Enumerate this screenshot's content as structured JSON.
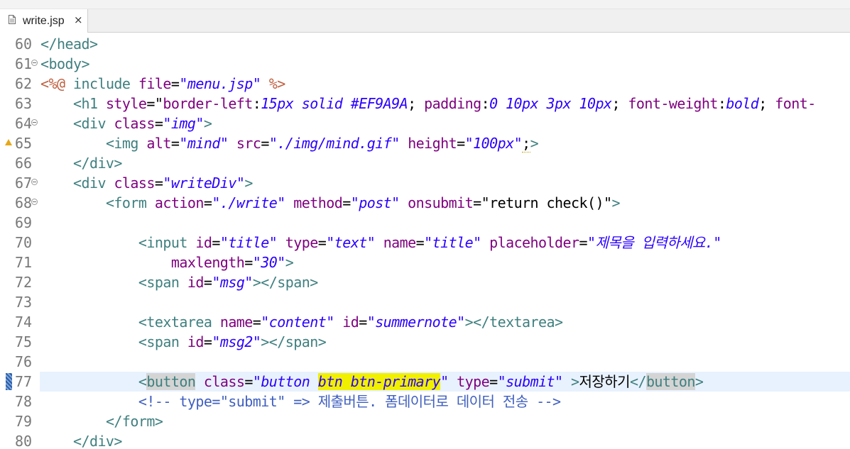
{
  "tab": {
    "filename": "write.jsp",
    "close_glyph": "×",
    "icon": "file-icon"
  },
  "colors": {
    "tag": "#3f7f7f",
    "attribute": "#7f007f",
    "string": "#2a00ff",
    "jsp": "#bf5f3f",
    "comment": "#3f5fbf",
    "current_line": "#e8f2fe",
    "highlight": "#f0f000"
  },
  "lines": [
    {
      "n": "60",
      "fold": false,
      "tokens": [
        {
          "t": "</head>",
          "c": "t-tagname"
        }
      ]
    },
    {
      "n": "61",
      "fold": true,
      "tokens": [
        {
          "t": "<body>",
          "c": "t-tagname"
        }
      ]
    },
    {
      "n": "62",
      "fold": false,
      "tokens": [
        {
          "t": "<%@",
          "c": "t-jsp"
        },
        {
          "t": " include ",
          "c": "t-tagname"
        },
        {
          "t": "file",
          "c": "t-attr"
        },
        {
          "t": "=",
          "c": "t-plain"
        },
        {
          "t": "\"menu.jsp\"",
          "c": "t-str"
        },
        {
          "t": " ",
          "c": "t-plain"
        },
        {
          "t": "%>",
          "c": "t-jsp"
        }
      ]
    },
    {
      "n": "63",
      "fold": false,
      "tokens": [
        {
          "t": "    ",
          "c": "t-plain"
        },
        {
          "t": "<h1 ",
          "c": "t-tagname"
        },
        {
          "t": "style",
          "c": "t-attr"
        },
        {
          "t": "=\"",
          "c": "t-plain"
        },
        {
          "t": "border-left",
          "c": "t-attr"
        },
        {
          "t": ":",
          "c": "t-plain"
        },
        {
          "t": "15px solid #EF9A9A",
          "c": "t-val"
        },
        {
          "t": "; ",
          "c": "t-plain"
        },
        {
          "t": "padding",
          "c": "t-attr"
        },
        {
          "t": ":",
          "c": "t-plain"
        },
        {
          "t": "0 10px 3px 10px",
          "c": "t-val"
        },
        {
          "t": "; ",
          "c": "t-plain"
        },
        {
          "t": "font-weight",
          "c": "t-attr"
        },
        {
          "t": ":",
          "c": "t-plain"
        },
        {
          "t": "bold",
          "c": "t-val"
        },
        {
          "t": "; ",
          "c": "t-plain"
        },
        {
          "t": "font-",
          "c": "t-attr"
        }
      ]
    },
    {
      "n": "64",
      "fold": true,
      "tokens": [
        {
          "t": "    ",
          "c": "t-plain"
        },
        {
          "t": "<div ",
          "c": "t-tagname"
        },
        {
          "t": "class",
          "c": "t-attr"
        },
        {
          "t": "=",
          "c": "t-plain"
        },
        {
          "t": "\"img\"",
          "c": "t-str"
        },
        {
          "t": ">",
          "c": "t-tagname"
        }
      ]
    },
    {
      "n": "65",
      "fold": false,
      "warn": true,
      "tokens": [
        {
          "t": "        ",
          "c": "t-plain"
        },
        {
          "t": "<img ",
          "c": "t-tagname"
        },
        {
          "t": "alt",
          "c": "t-attr"
        },
        {
          "t": "=",
          "c": "t-plain"
        },
        {
          "t": "\"mind\"",
          "c": "t-str"
        },
        {
          "t": " ",
          "c": "t-plain"
        },
        {
          "t": "src",
          "c": "t-attr"
        },
        {
          "t": "=",
          "c": "t-plain"
        },
        {
          "t": "\"./img/mind.gif\"",
          "c": "t-str"
        },
        {
          "t": " ",
          "c": "t-plain"
        },
        {
          "t": "height",
          "c": "t-attr"
        },
        {
          "t": "=",
          "c": "t-plain"
        },
        {
          "t": "\"100px\"",
          "c": "t-str"
        },
        {
          "t": ";",
          "c": "t-plain caret-mark"
        },
        {
          "t": ">",
          "c": "t-tagname"
        }
      ]
    },
    {
      "n": "66",
      "fold": false,
      "tokens": [
        {
          "t": "    ",
          "c": "t-plain"
        },
        {
          "t": "</div>",
          "c": "t-tagname"
        }
      ]
    },
    {
      "n": "67",
      "fold": true,
      "tokens": [
        {
          "t": "    ",
          "c": "t-plain"
        },
        {
          "t": "<div ",
          "c": "t-tagname"
        },
        {
          "t": "class",
          "c": "t-attr"
        },
        {
          "t": "=",
          "c": "t-plain"
        },
        {
          "t": "\"writeDiv\"",
          "c": "t-str"
        },
        {
          "t": ">",
          "c": "t-tagname"
        }
      ]
    },
    {
      "n": "68",
      "fold": true,
      "tokens": [
        {
          "t": "        ",
          "c": "t-plain"
        },
        {
          "t": "<form ",
          "c": "t-tagname"
        },
        {
          "t": "action",
          "c": "t-attr"
        },
        {
          "t": "=",
          "c": "t-plain"
        },
        {
          "t": "\"./write\"",
          "c": "t-str"
        },
        {
          "t": " ",
          "c": "t-plain"
        },
        {
          "t": "method",
          "c": "t-attr"
        },
        {
          "t": "=",
          "c": "t-plain"
        },
        {
          "t": "\"post\"",
          "c": "t-str"
        },
        {
          "t": " ",
          "c": "t-plain"
        },
        {
          "t": "onsubmit",
          "c": "t-attr"
        },
        {
          "t": "=\"return check()\"",
          "c": "t-plain"
        },
        {
          "t": ">",
          "c": "t-tagname"
        }
      ]
    },
    {
      "n": "69",
      "fold": false,
      "tokens": []
    },
    {
      "n": "70",
      "fold": false,
      "tokens": [
        {
          "t": "            ",
          "c": "t-plain"
        },
        {
          "t": "<input ",
          "c": "t-tagname"
        },
        {
          "t": "id",
          "c": "t-attr"
        },
        {
          "t": "=",
          "c": "t-plain"
        },
        {
          "t": "\"title\"",
          "c": "t-str"
        },
        {
          "t": " ",
          "c": "t-plain"
        },
        {
          "t": "type",
          "c": "t-attr"
        },
        {
          "t": "=",
          "c": "t-plain"
        },
        {
          "t": "\"text\"",
          "c": "t-str"
        },
        {
          "t": " ",
          "c": "t-plain"
        },
        {
          "t": "name",
          "c": "t-attr"
        },
        {
          "t": "=",
          "c": "t-plain"
        },
        {
          "t": "\"title\"",
          "c": "t-str"
        },
        {
          "t": " ",
          "c": "t-plain"
        },
        {
          "t": "placeholder",
          "c": "t-attr"
        },
        {
          "t": "=",
          "c": "t-plain"
        },
        {
          "t": "\"제목을 입력하세요.\"",
          "c": "t-str"
        }
      ]
    },
    {
      "n": "71",
      "fold": false,
      "tokens": [
        {
          "t": "                ",
          "c": "t-plain"
        },
        {
          "t": "maxlength",
          "c": "t-attr"
        },
        {
          "t": "=",
          "c": "t-plain"
        },
        {
          "t": "\"30\"",
          "c": "t-str"
        },
        {
          "t": ">",
          "c": "t-tagname"
        }
      ]
    },
    {
      "n": "72",
      "fold": false,
      "tokens": [
        {
          "t": "            ",
          "c": "t-plain"
        },
        {
          "t": "<span ",
          "c": "t-tagname"
        },
        {
          "t": "id",
          "c": "t-attr"
        },
        {
          "t": "=",
          "c": "t-plain"
        },
        {
          "t": "\"msg\"",
          "c": "t-str"
        },
        {
          "t": "></span>",
          "c": "t-tagname"
        }
      ]
    },
    {
      "n": "73",
      "fold": false,
      "tokens": []
    },
    {
      "n": "74",
      "fold": false,
      "tokens": [
        {
          "t": "            ",
          "c": "t-plain"
        },
        {
          "t": "<textarea ",
          "c": "t-tagname"
        },
        {
          "t": "name",
          "c": "t-attr"
        },
        {
          "t": "=",
          "c": "t-plain"
        },
        {
          "t": "\"content\"",
          "c": "t-str"
        },
        {
          "t": " ",
          "c": "t-plain"
        },
        {
          "t": "id",
          "c": "t-attr"
        },
        {
          "t": "=",
          "c": "t-plain"
        },
        {
          "t": "\"summernote\"",
          "c": "t-str"
        },
        {
          "t": "></textarea>",
          "c": "t-tagname"
        }
      ]
    },
    {
      "n": "75",
      "fold": false,
      "tokens": [
        {
          "t": "            ",
          "c": "t-plain"
        },
        {
          "t": "<span ",
          "c": "t-tagname"
        },
        {
          "t": "id",
          "c": "t-attr"
        },
        {
          "t": "=",
          "c": "t-plain"
        },
        {
          "t": "\"msg2\"",
          "c": "t-str"
        },
        {
          "t": "></span>",
          "c": "t-tagname"
        }
      ]
    },
    {
      "n": "76",
      "fold": false,
      "tokens": []
    },
    {
      "n": "77",
      "fold": false,
      "current": true,
      "marker": true,
      "tokens": [
        {
          "t": "            ",
          "c": "t-plain"
        },
        {
          "t": "<",
          "c": "t-tagname"
        },
        {
          "t": "button",
          "c": "t-tagname t-occ"
        },
        {
          "t": " ",
          "c": "t-plain"
        },
        {
          "t": "class",
          "c": "t-attr"
        },
        {
          "t": "=",
          "c": "t-plain"
        },
        {
          "t": "\"button ",
          "c": "t-str"
        },
        {
          "t": "btn btn-primary",
          "c": "t-str t-hl"
        },
        {
          "t": "\"",
          "c": "t-str"
        },
        {
          "t": " ",
          "c": "t-plain"
        },
        {
          "t": "type",
          "c": "t-attr"
        },
        {
          "t": "=",
          "c": "t-plain"
        },
        {
          "t": "\"submit\"",
          "c": "t-str"
        },
        {
          "t": " ",
          "c": "t-plain"
        },
        {
          "t": ">",
          "c": "t-tagname"
        },
        {
          "t": "저장하기",
          "c": "t-plain"
        },
        {
          "t": "</",
          "c": "t-tagname"
        },
        {
          "t": "button",
          "c": "t-tagname t-occ"
        },
        {
          "t": ">",
          "c": "t-tagname"
        }
      ]
    },
    {
      "n": "78",
      "fold": false,
      "tokens": [
        {
          "t": "            ",
          "c": "t-plain"
        },
        {
          "t": "<!-- type=\"submit\" => 제출버튼. 폼데이터로 데이터 전송 -->",
          "c": "t-comment"
        }
      ]
    },
    {
      "n": "79",
      "fold": false,
      "tokens": [
        {
          "t": "        ",
          "c": "t-plain"
        },
        {
          "t": "</form>",
          "c": "t-tagname"
        }
      ]
    },
    {
      "n": "80",
      "fold": false,
      "tokens": [
        {
          "t": "    ",
          "c": "t-plain"
        },
        {
          "t": "</div>",
          "c": "t-tagname"
        }
      ]
    }
  ]
}
